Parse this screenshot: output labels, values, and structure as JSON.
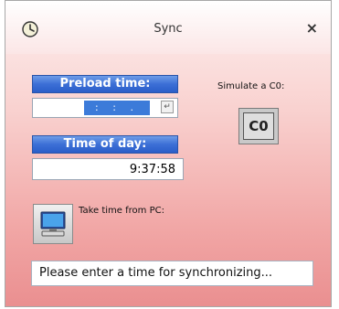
{
  "window": {
    "title": "Sync",
    "close_glyph": "×",
    "icon": "clock-icon"
  },
  "preload": {
    "label": "Preload time:",
    "value_mask": ":  :  .",
    "enter_icon": "enter-icon",
    "enter_glyph": "↵"
  },
  "time_of_day": {
    "label": "Time of day:",
    "value": "9:37:58"
  },
  "simulate": {
    "label": "Simulate a C0:",
    "button_label": "C0"
  },
  "take_time": {
    "label": "Take time from PC:",
    "icon": "computer-icon"
  },
  "status": {
    "text": "Please enter a time for synchronizing..."
  },
  "colors": {
    "label_bar": "#3c6fd6",
    "background_top": "#fdf0ef",
    "background_bottom": "#ea8f90"
  }
}
